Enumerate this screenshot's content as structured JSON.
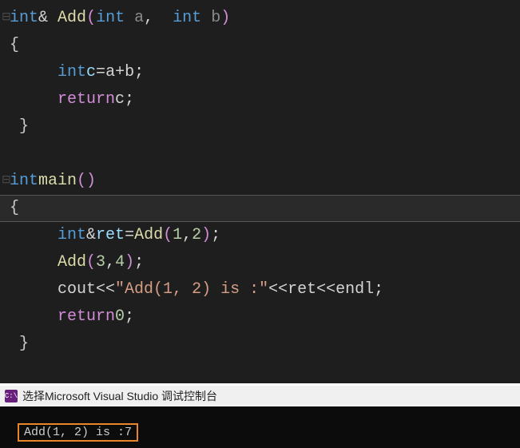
{
  "code": {
    "line1": {
      "gutter": "⊟",
      "type": "int",
      "amp": "&",
      "func": "Add",
      "lp": "(",
      "p1t": "int",
      "p1": "a",
      "comma": ",",
      "p2t": "int",
      "p2": "b",
      "rp": ")"
    },
    "line2": {
      "brace": "{"
    },
    "line3": {
      "type": "int",
      "var": "c",
      "eq": "=",
      "a": "a",
      "plus": "+",
      "b": "b",
      "semi": ";"
    },
    "line4": {
      "kw": "return",
      "var": "c",
      "semi": ";"
    },
    "line5": {
      "brace": "}"
    },
    "line6": {
      "blank": ""
    },
    "line7": {
      "gutter": "⊟",
      "type": "int",
      "func": "main",
      "lp": "(",
      "rp": ")"
    },
    "line8": {
      "brace": "{"
    },
    "line9": {
      "type": "int",
      "amp": "&",
      "var": "ret",
      "eq": "=",
      "func": "Add",
      "lp": "(",
      "n1": "1",
      "comma": ",",
      "n2": "2",
      "rp": ")",
      "semi": ";"
    },
    "line10": {
      "func": "Add",
      "lp": "(",
      "n1": "3",
      "comma": ",",
      "n2": "4",
      "rp": ")",
      "semi": ";"
    },
    "line11": {
      "cout": "cout",
      "ll1": "<<",
      "str": "\"Add(1, 2) is :\"",
      "ll2": "<<",
      "var": "ret",
      "ll3": "<<",
      "endl": "endl",
      "semi": ";"
    },
    "line12": {
      "kw": "return",
      "n": "0",
      "semi": ";"
    },
    "line13": {
      "brace": "}"
    }
  },
  "console": {
    "icon_text": "C:\\",
    "title": "选择Microsoft Visual Studio 调试控制台",
    "output": "Add(1, 2) is :7"
  }
}
